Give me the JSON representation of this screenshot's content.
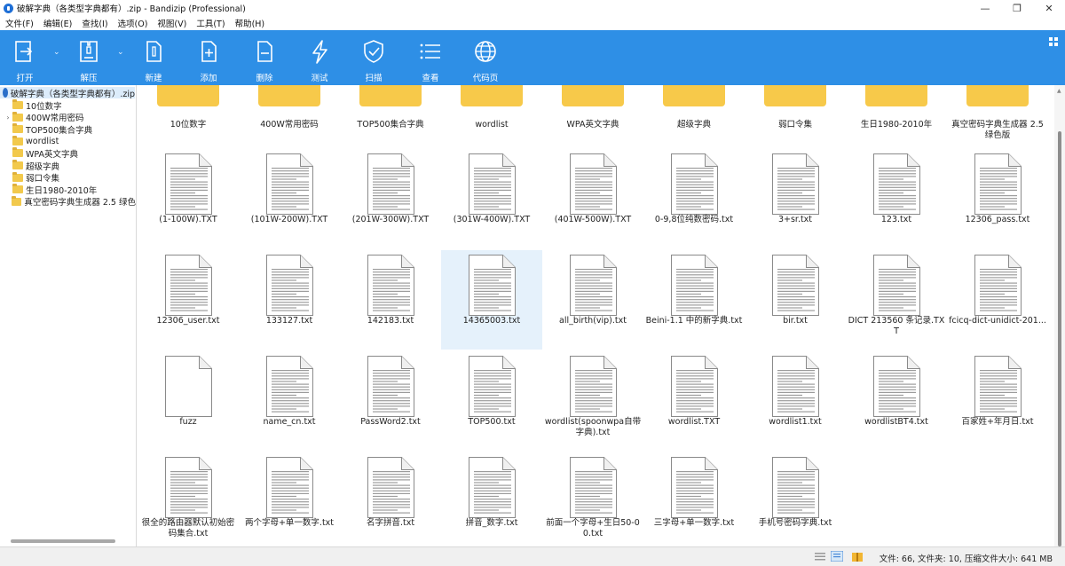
{
  "window": {
    "title": "破解字典（各类型字典都有）.zip - Bandizip (Professional)"
  },
  "menu": [
    "文件(F)",
    "编辑(E)",
    "查找(I)",
    "选项(O)",
    "视图(V)",
    "工具(T)",
    "帮助(H)"
  ],
  "toolbar": [
    {
      "key": "open",
      "label": "打开",
      "icon": "open-archive-icon"
    },
    {
      "key": "extract",
      "label": "解压",
      "icon": "extract-zipper-icon"
    },
    {
      "key": "new",
      "label": "新建",
      "icon": "new-archive-icon"
    },
    {
      "key": "add",
      "label": "添加",
      "icon": "add-file-icon"
    },
    {
      "key": "delete",
      "label": "删除",
      "icon": "delete-file-icon"
    },
    {
      "key": "test",
      "label": "测试",
      "icon": "test-lightning-icon"
    },
    {
      "key": "scan",
      "label": "扫描",
      "icon": "scan-shield-icon"
    },
    {
      "key": "view",
      "label": "查看",
      "icon": "view-list-icon"
    },
    {
      "key": "codepage",
      "label": "代码页",
      "icon": "codepage-globe-icon"
    }
  ],
  "tree": {
    "root": "破解字典（各类型字典都有）.zip",
    "items": [
      "10位数字",
      "400W常用密码",
      "TOP500集合字典",
      "wordlist",
      "WPA英文字典",
      "超级字典",
      "弱口令集",
      "生日1980-2010年",
      "真空密码字典生成器 2.5 绿色"
    ]
  },
  "folders": [
    "10位数字",
    "400W常用密码",
    "TOP500集合字典",
    "wordlist",
    "WPA英文字典",
    "超级字典",
    "弱口令集",
    "生日1980-2010年",
    "真空密码字典生成器 2.5 绿色版"
  ],
  "files": [
    "(1-100W).TXT",
    "(101W-200W).TXT",
    "(201W-300W).TXT",
    "(301W-400W).TXT",
    "(401W-500W).TXT",
    "0-9,8位纯数密码.txt",
    "3+sr.txt",
    "123.txt",
    "12306_pass.txt",
    "12306_user.txt",
    "133127.txt",
    "142183.txt",
    "14365003.txt",
    "all_birth(vip).txt",
    "Beini-1.1 中的新字典.txt",
    "bir.txt",
    "DICT 213560 条记录.TXT",
    "fcicq-dict-unidict-201...",
    "fuzz",
    "name_cn.txt",
    "PassWord2.txt",
    "TOP500.txt",
    "wordlist(spoonwpa自带字典).txt",
    "wordlist.TXT",
    "wordlist1.txt",
    "wordlistBT4.txt",
    "百家姓+年月日.txt",
    "很全的路由器默认初始密码集合.txt",
    "两个字母+单一数字.txt",
    "名字拼音.txt",
    "拼音_数字.txt",
    "前面一个字母+生日50-00.txt",
    "三字母+单一数字.txt",
    "手机号密码字典.txt"
  ],
  "selected_file": "14365003.txt",
  "blank_file": "fuzz",
  "status": {
    "text": "文件: 66, 文件夹: 10, 压缩文件大小: 641 MB"
  },
  "colors": {
    "toolbar": "#2e8fe6",
    "folder": "#f7c94a",
    "selection": "#e5f1fb"
  }
}
